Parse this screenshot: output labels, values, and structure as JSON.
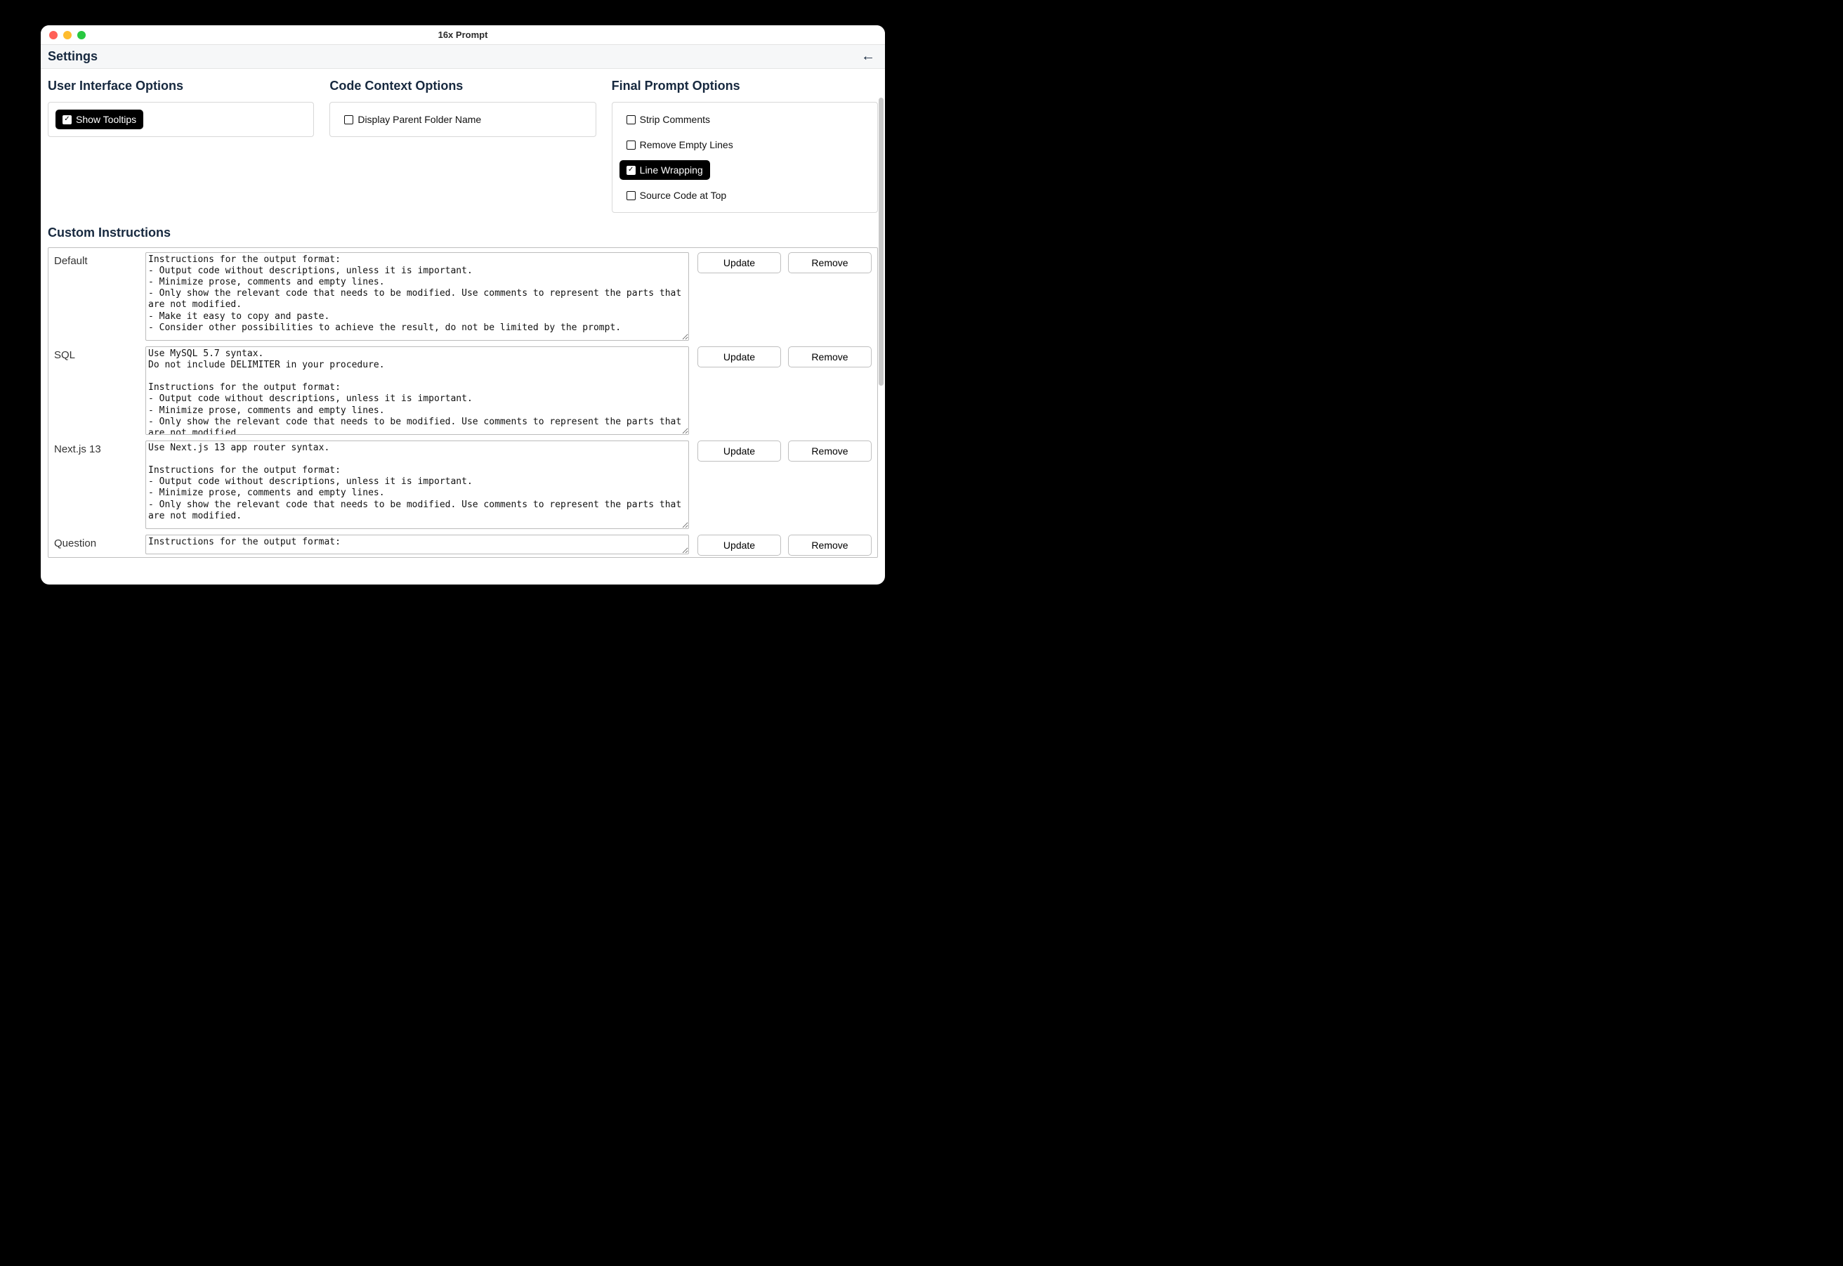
{
  "window": {
    "title": "16x Prompt"
  },
  "header": {
    "title": "Settings"
  },
  "columns": {
    "ui": {
      "title": "User Interface Options",
      "items": [
        {
          "label": "Show Tooltips",
          "checked": true
        }
      ]
    },
    "code": {
      "title": "Code Context Options",
      "items": [
        {
          "label": "Display Parent Folder Name",
          "checked": false
        }
      ]
    },
    "final": {
      "title": "Final Prompt Options",
      "items": [
        {
          "label": "Strip Comments",
          "checked": false
        },
        {
          "label": "Remove Empty Lines",
          "checked": false
        },
        {
          "label": "Line Wrapping",
          "checked": true
        },
        {
          "label": "Source Code at Top",
          "checked": false
        }
      ]
    }
  },
  "custom": {
    "title": "Custom Instructions",
    "buttons": {
      "update": "Update",
      "remove": "Remove"
    },
    "rows": [
      {
        "name": "Default",
        "text": "Instructions for the output format:\n- Output code without descriptions, unless it is important.\n- Minimize prose, comments and empty lines.\n- Only show the relevant code that needs to be modified. Use comments to represent the parts that are not modified.\n- Make it easy to copy and paste.\n- Consider other possibilities to achieve the result, do not be limited by the prompt."
      },
      {
        "name": "SQL",
        "text": "Use MySQL 5.7 syntax.\nDo not include DELIMITER in your procedure.\n\nInstructions for the output format:\n- Output code without descriptions, unless it is important.\n- Minimize prose, comments and empty lines.\n- Only show the relevant code that needs to be modified. Use comments to represent the parts that are not modified."
      },
      {
        "name": "Next.js 13",
        "text": "Use Next.js 13 app router syntax.\n\nInstructions for the output format:\n- Output code without descriptions, unless it is important.\n- Minimize prose, comments and empty lines.\n- Only show the relevant code that needs to be modified. Use comments to represent the parts that are not modified."
      },
      {
        "name": "Question",
        "text": "Instructions for the output format:"
      }
    ]
  }
}
